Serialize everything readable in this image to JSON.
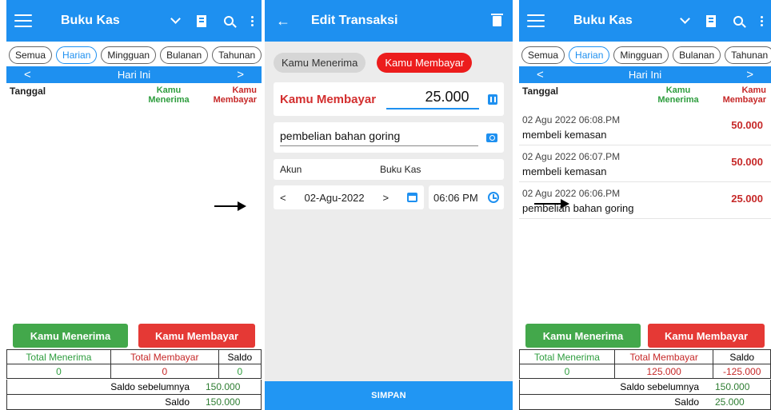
{
  "home_before": {
    "app_title": "Buku Kas",
    "filters": [
      "Semua",
      "Harian",
      "Mingguan",
      "Bulanan",
      "Tahunan"
    ],
    "active_filter": "Harian",
    "day_label": "Hari Ini",
    "columns": {
      "date": "Tanggal",
      "in": "Kamu Menerima",
      "out": "Kamu Membayar"
    },
    "btn_in": "Kamu Menerima",
    "btn_out": "Kamu Membayar",
    "totals": {
      "label_in": "Total Menerima",
      "label_out": "Total Membayar",
      "label_saldo": "Saldo",
      "value_in": "0",
      "value_out": "0",
      "value_saldo": "0"
    },
    "prev_balance_label": "Saldo sebelumnya",
    "prev_balance": "150.000",
    "balance_label": "Saldo",
    "balance": "150.000"
  },
  "edit": {
    "title": "Edit Transaksi",
    "toggle_in": "Kamu Menerima",
    "toggle_out": "Kamu Membayar",
    "amount_label": "Kamu Membayar",
    "amount": "25.000",
    "note": "pembelian bahan goring",
    "account_label": "Akun",
    "account_value": "Buku Kas",
    "date": "02-Agu-2022",
    "time": "06:06 PM",
    "save_label": "SIMPAN"
  },
  "home_after": {
    "app_title": "Buku Kas",
    "filters": [
      "Semua",
      "Harian",
      "Mingguan",
      "Bulanan",
      "Tahunan"
    ],
    "active_filter": "Harian",
    "day_label": "Hari Ini",
    "columns": {
      "date": "Tanggal",
      "in": "Kamu Menerima",
      "out": "Kamu Membayar"
    },
    "transactions": [
      {
        "date": "02 Agu 2022 06:08.PM",
        "desc": "membeli kemasan",
        "amount": "50.000"
      },
      {
        "date": "02 Agu 2022 06:07.PM",
        "desc": "membeli kemasan",
        "amount": "50.000"
      },
      {
        "date": "02 Agu 2022 06:06.PM",
        "desc": "pembelian bahan goring",
        "amount": "25.000"
      }
    ],
    "btn_in": "Kamu Menerima",
    "btn_out": "Kamu Membayar",
    "totals": {
      "label_in": "Total Menerima",
      "label_out": "Total Membayar",
      "label_saldo": "Saldo",
      "value_in": "0",
      "value_out": "125.000",
      "value_saldo": "-125.000"
    },
    "prev_balance_label": "Saldo sebelumnya",
    "prev_balance": "150.000",
    "balance_label": "Saldo",
    "balance": "25.000"
  },
  "colors": {
    "primary": "#1e90f0",
    "in_green": "#43a84b",
    "out_red": "#e53935"
  }
}
